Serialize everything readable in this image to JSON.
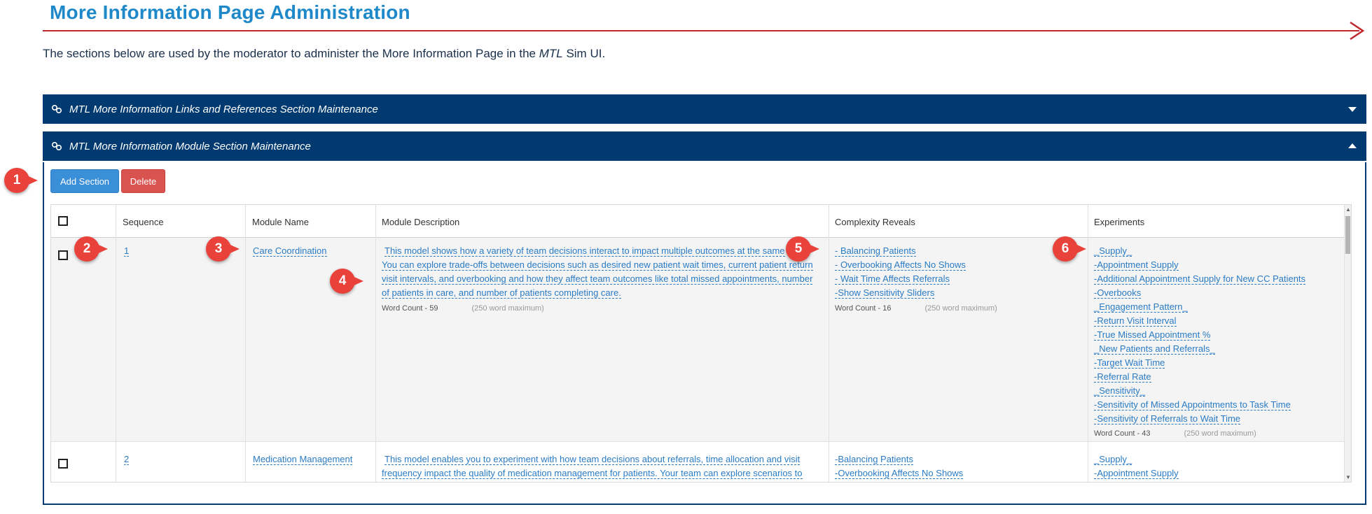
{
  "page": {
    "title": "More Information Page Administration",
    "intro_prefix": "The sections below are used by the moderator to administer the More Information Page in the ",
    "intro_em": "MTL",
    "intro_suffix": " Sim UI."
  },
  "panels": [
    {
      "label": "MTL More Information Links and References Section Maintenance",
      "state": "collapsed"
    },
    {
      "label": "MTL More Information Module Section Maintenance",
      "state": "expanded"
    }
  ],
  "buttons": {
    "add": "Add Section",
    "delete": "Delete"
  },
  "table": {
    "headers": [
      "Sequence",
      "Module Name",
      "Module Description",
      "Complexity Reveals",
      "Experiments"
    ],
    "rows": [
      {
        "sequence": "1",
        "module_name": "Care Coordination",
        "description_lines": [
          "This model shows how a variety of team decisions interact to impact multiple outcomes at the same",
          "You can explore trade-offs between decisions such as desired new patient wait times, current patient return",
          "visit intervals, and overbooking and how they affect team outcomes like total missed appointments, number",
          "of patients in care, and number of patients completing care."
        ],
        "description_word_count": "Word Count -  59",
        "complexity": [
          "- Balancing Patients",
          "- Overbooking Affects No Shows",
          "- Wait Time Affects Referrals",
          "-Show Sensitivity Sliders"
        ],
        "complexity_word_count": "Word Count -  16",
        "experiments": [
          "_Supply_",
          "-Appointment Supply",
          "-Additional Appointment Supply for New CC Patients",
          "-Overbooks",
          "_Engagement Pattern_",
          "-Return Visit Interval",
          "-True Missed Appointment %",
          "_New Patients and Referrals_",
          "-Target Wait Time",
          "-Referral Rate",
          "_Sensitivity_",
          "-Sensitivity of Missed Appointments to Task Time",
          "-Sensitivity of Referrals to Wait Time"
        ],
        "experiments_word_count": "Word Count -  43"
      },
      {
        "sequence": "2",
        "module_name": "Medication Management",
        "description_lines": [
          "This model enables you to experiment with how team decisions about referrals, time allocation and visit",
          "frequency impact the quality of medication management for patients. Your team can explore scenarios to"
        ],
        "complexity": [
          "-Balancing Patients",
          "-Overbooking Affects No Shows"
        ],
        "experiments": [
          "_Supply_",
          "-Appointment Supply"
        ]
      }
    ],
    "word_max": "(250 word maximum)"
  },
  "markers": [
    "1",
    "2",
    "3",
    "4",
    "5",
    "6"
  ],
  "colors": {
    "accent": "#1e88c9",
    "header_bg": "#003a70",
    "rule": "#c0272d",
    "marker": "#e8423b",
    "link": "#2a7bc4"
  }
}
